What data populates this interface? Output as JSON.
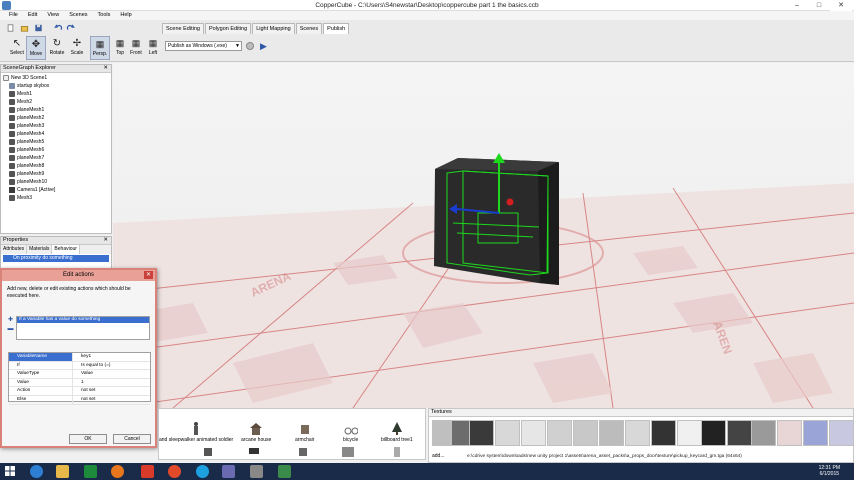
{
  "window": {
    "title": "CopperCube - C:\\Users\\S4newstar\\Desktop\\coppercube part 1 the basics.ccb"
  },
  "menu": [
    "File",
    "Edit",
    "View",
    "Scenes",
    "Tools",
    "Help"
  ],
  "tools": [
    "Select",
    "Move",
    "Rotate",
    "Scale",
    "Persp.",
    "Top",
    "Front",
    "Left"
  ],
  "tabs": [
    "Scene Editing",
    "Polygon Editing",
    "Light Mapping",
    "Scenes",
    "Publish"
  ],
  "publish": {
    "target": "Publish as Windows (.exe)"
  },
  "scenegraph": {
    "title": "SceneGraph Explorer",
    "items": [
      "New 3D Scene1",
      "startup skybox",
      "Mesh1",
      "Mesh2",
      "planeMesh1",
      "planeMesh2",
      "planeMesh3",
      "planeMesh4",
      "planeMesh5",
      "planeMesh6",
      "planeMesh7",
      "planeMesh8",
      "planeMesh9",
      "planeMesh10",
      "Camera1 [Active]",
      "Mesh3"
    ]
  },
  "properties": {
    "title": "Properties",
    "tabs": [
      "Attributes",
      "Materials",
      "Behaviour"
    ],
    "selected": "On proximity do something"
  },
  "dialog": {
    "title": "Edit actions",
    "description": "Add new, delete or edit existing actions which should be executed here.",
    "action_item": "If a Variable has a value do something",
    "rows": [
      {
        "k": "VariableName",
        "v": "key1"
      },
      {
        "k": "If",
        "v": "Is equal to (=)"
      },
      {
        "k": "ValueType",
        "v": "Value"
      },
      {
        "k": "Value",
        "v": "1"
      },
      {
        "k": "Action",
        "v": "not set"
      },
      {
        "k": "Else",
        "v": "not set"
      }
    ],
    "ok": "OK",
    "cancel": "Cancel"
  },
  "models": {
    "items": [
      "and sleepwalker animated soldier",
      "arcane house",
      "armchair",
      "bicycle",
      "billboard tree1"
    ]
  },
  "textures": {
    "title": "Textures",
    "add": "add...",
    "path": "e:\\cdrive system\\downloads\\new unity project 1\\assets\\arena_asset_packs\\a_props_door\\texture\\pickup_keycard_gm.tga (64x64)"
  },
  "taskbar": {
    "time": "12:31 PM",
    "date": "6/1/2015"
  }
}
